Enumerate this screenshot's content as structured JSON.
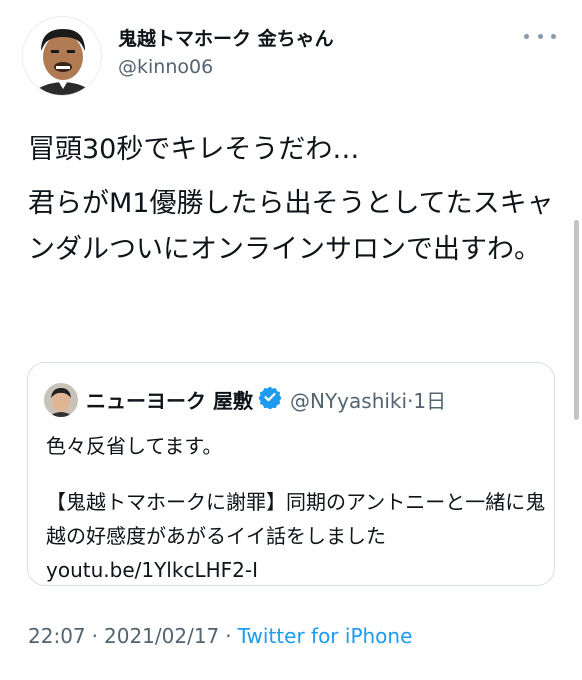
{
  "author": {
    "name": "鬼越トマホーク 金ちゃん",
    "handle": "@kinno06"
  },
  "tweet": {
    "paragraphs": [
      "冒頭30秒でキレそうだわ…",
      "君らがM1優勝したら出そうとしてたスキャンダルついにオンラインサロンで出すわ。"
    ]
  },
  "quote": {
    "name": "ニューヨーク 屋敷",
    "handle": "@NYyashiki",
    "time": "1日",
    "line1": "色々反省してます。",
    "line2": "【鬼越トマホークに謝罪】同期のアントニーと一緒に鬼越の好感度があがるイイ話をしました",
    "link": "youtu.be/1YlkcLHF2-I"
  },
  "meta": {
    "time": "22:07",
    "date": "2021/02/17",
    "source": "Twitter for iPhone"
  },
  "colors": {
    "text": "#0f1419",
    "secondary": "#536471",
    "accent": "#1d9bf0",
    "border": "#d8dfe5"
  }
}
